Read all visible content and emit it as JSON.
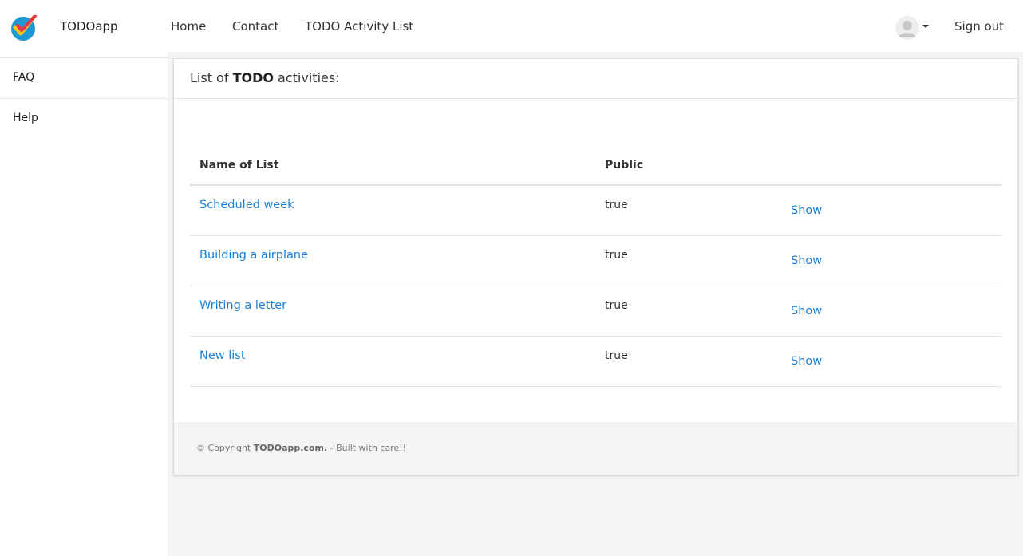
{
  "brand": {
    "name": "TODOapp",
    "logo_icon": "check-logo-icon"
  },
  "nav": {
    "links": [
      "Home",
      "Contact",
      "TODO Activity List"
    ],
    "sign_out": "Sign out"
  },
  "sidebar": {
    "items": [
      {
        "label": "FAQ"
      },
      {
        "label": "Help"
      }
    ]
  },
  "card": {
    "title_prefix": "List of ",
    "title_bold": "TODO",
    "title_suffix": " activities:"
  },
  "table": {
    "headers": [
      "Name of List",
      "Public"
    ],
    "rows": [
      {
        "name": "Scheduled week",
        "public": "true",
        "action": "Show"
      },
      {
        "name": "Building a airplane",
        "public": "true",
        "action": "Show"
      },
      {
        "name": "Writing a letter",
        "public": "true",
        "action": "Show"
      },
      {
        "name": "New list",
        "public": "true",
        "action": "Show"
      }
    ]
  },
  "footer": {
    "prefix": "© Copyright ",
    "brand": "TODOapp.com.",
    "suffix": " - Built with care!!"
  },
  "colors": {
    "link": "#1a7fd6",
    "logo_blue": "#1f9ad6",
    "logo_red": "#e8344e",
    "logo_yellow": "#f5c518"
  }
}
